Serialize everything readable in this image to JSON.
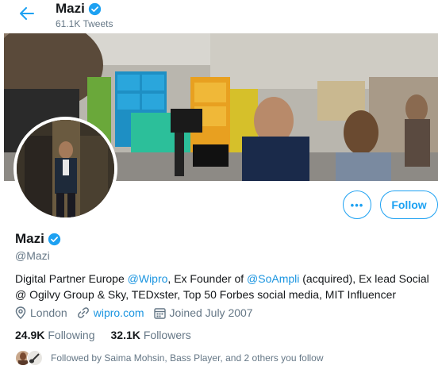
{
  "header": {
    "name": "Mazi",
    "tweet_count": "61.1K Tweets",
    "back_icon": "arrow-left-icon"
  },
  "profile": {
    "display_name": "Mazi",
    "handle": "@Mazi",
    "verified": true,
    "bio": {
      "t1": "Digital Partner Europe ",
      "m1": "@Wipro",
      "t2": ", Ex Founder of ",
      "m2": "@SoAmpli",
      "t3": " (acquired), Ex lead Social @ Ogilvy Group & Sky, TEDxster, Top 50 Forbes social media, MIT Influencer"
    },
    "location": "London",
    "website": "wipro.com",
    "joined": "Joined July 2007"
  },
  "stats": {
    "following_count": "24.9K",
    "following_label": "Following",
    "followers_count": "32.1K",
    "followers_label": "Followers"
  },
  "followed_by": {
    "text": "Followed by Saima Mohsin, Bass Player, and 2 others you follow"
  },
  "actions": {
    "more_label": "•••",
    "follow_label": "Follow"
  },
  "colors": {
    "accent": "#1da1f2",
    "link": "#1b95e0",
    "secondary_text": "#657786",
    "primary_text": "#14171a"
  }
}
